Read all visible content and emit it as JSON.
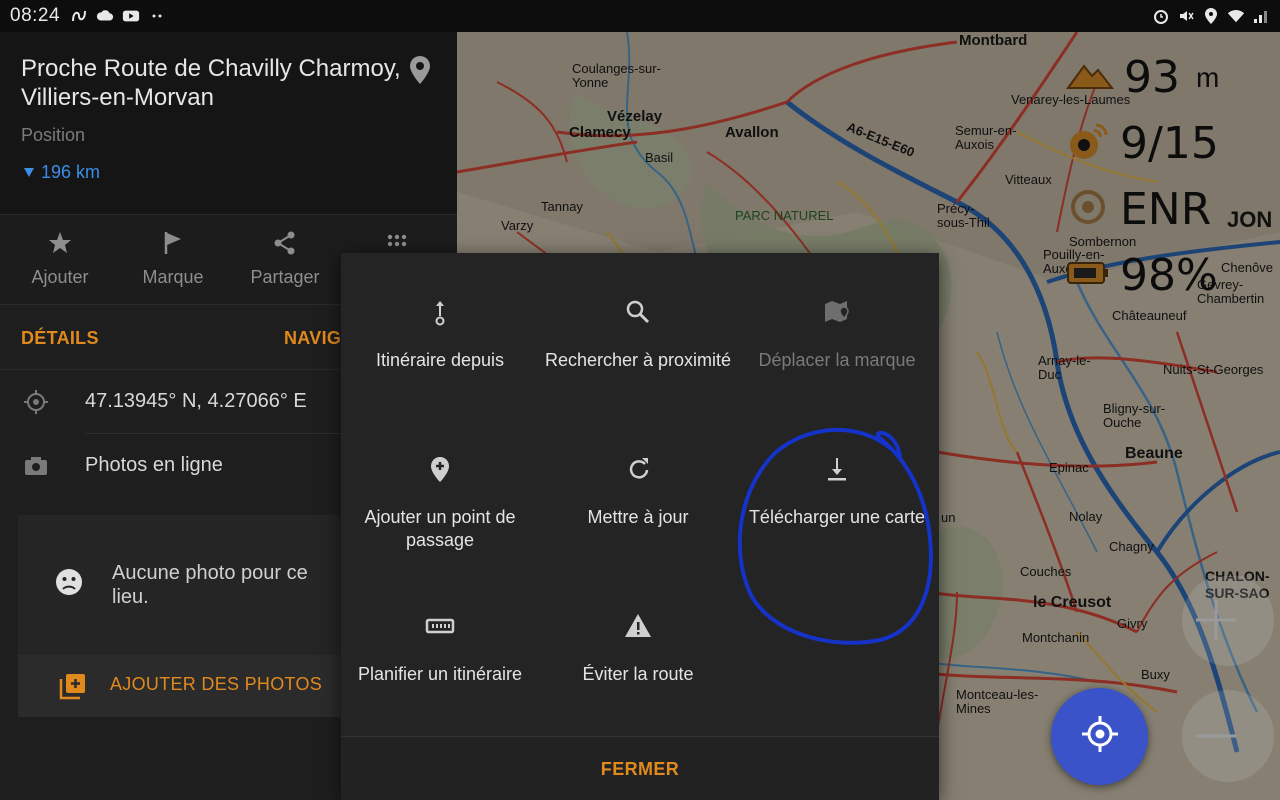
{
  "status_bar": {
    "time": "08:24",
    "left_icons": [
      "ondemand-icon",
      "cloud-icon",
      "youtube-icon",
      "dots-icon"
    ],
    "right_icons": [
      "alarm-icon",
      "mute-icon",
      "location-icon",
      "wifi-icon",
      "signal-icon"
    ]
  },
  "place": {
    "title": "Proche Route de Chavilly Charmoy, Villiers-en-Morvan",
    "subtitle": "Position",
    "distance": "196 km"
  },
  "actions": [
    {
      "label": "Ajouter",
      "icon": "star-icon"
    },
    {
      "label": "Marque",
      "icon": "flag-icon"
    },
    {
      "label": "Partager",
      "icon": "share-icon"
    },
    {
      "label": "",
      "icon": "more-grid-icon"
    }
  ],
  "tabs": {
    "details": "DÉTAILS",
    "navigation": "NAVIG"
  },
  "info_rows": {
    "coordinates": "47.13945° N, 4.27066° E",
    "online_photos": "Photos en ligne"
  },
  "photos": {
    "empty_message": "Aucune photo pour ce lieu.",
    "add_button": "AJOUTER DES PHOTOS"
  },
  "menu": {
    "items": [
      {
        "label": "Itinéraire depuis",
        "icon": "route-from-icon",
        "enabled": true
      },
      {
        "label": "Rechercher à proximité",
        "icon": "search-icon",
        "enabled": true
      },
      {
        "label": "Déplacer la marque",
        "icon": "move-marker-icon",
        "enabled": false
      },
      {
        "label": "Ajouter un point de passage",
        "icon": "add-waypoint-icon",
        "enabled": true
      },
      {
        "label": "Mettre à jour",
        "icon": "refresh-icon",
        "enabled": true
      },
      {
        "label": "Télécharger une carte",
        "icon": "download-icon",
        "enabled": true
      },
      {
        "label": "Planifier un itinéraire",
        "icon": "ruler-icon",
        "enabled": true
      },
      {
        "label": "Éviter la route",
        "icon": "warning-icon",
        "enabled": true
      }
    ],
    "close_label": "FERMER"
  },
  "map_overlay": {
    "altitude_value": "93",
    "altitude_unit": "m",
    "satellites": "9/15",
    "recording": "ENR",
    "battery": "98%"
  },
  "map_labels": {
    "montbard": "Montbard",
    "vezelay": "Vézelay",
    "clamecy": "Clamecy",
    "avallon": "Avallon",
    "basil": "Basil",
    "coulanges": "Coulanges-sur-Yonne",
    "tannay": "Tannay",
    "varzy": "Varzy",
    "parc": "PARC NATUREL",
    "semur": "Semur-en-Auxois",
    "venarey": "Venarey-les-Laumes",
    "vitteaux": "Vitteaux",
    "sombernon": "Sombernon",
    "dijon": "JON",
    "chatauneuf": "Châteauneuf",
    "beaune": "Beaune",
    "nuits": "Nuits-St-Georges",
    "chenove": "Chenôve",
    "gevrey": "Gevrey-Chambertin",
    "epinac": "Epinac",
    "nolay": "Nolay",
    "chagny": "Chagny",
    "le_creusot": "le Creusot",
    "montchanin": "Montchanin",
    "chalon": "CHALON-SUR-SAO",
    "couches": "Couches",
    "givry": "Givry",
    "buxy": "Buxy",
    "montceau": "Montceau-les-Mines",
    "arnay": "Arnay-le-Duc",
    "bligny": "Bligny-sur-Ouche",
    "pouilly": "Pouilly-en-Auxois",
    "precy": "Précy-sous-Thil",
    "a6": "A6-E15-E60",
    "autun": "un"
  }
}
